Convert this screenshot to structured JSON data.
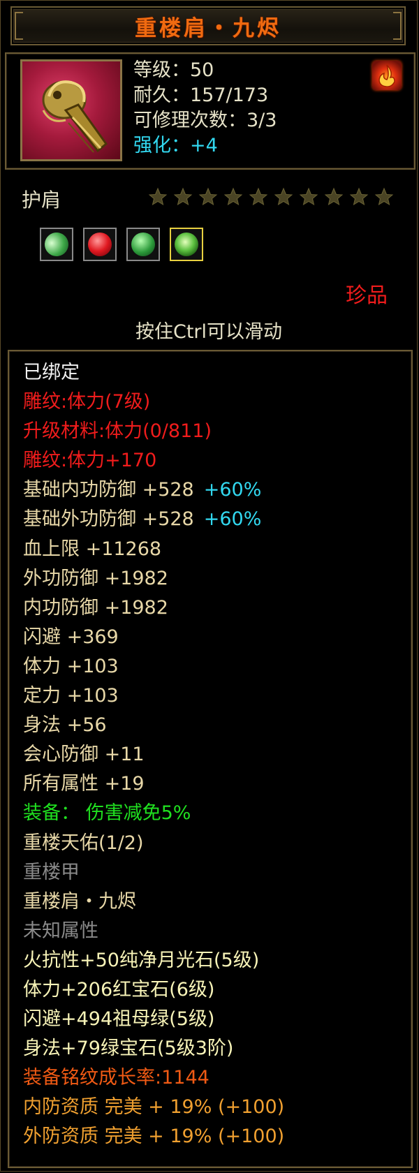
{
  "title": "重楼肩・九烬",
  "header": {
    "level": "等级：50",
    "durability": "耐久：157/173",
    "repairs": "可修理次数：3/3",
    "enhance": "强化：+4"
  },
  "slot_type": "护肩",
  "stars": {
    "total": 10,
    "filled": 0
  },
  "gems": [
    "moonstone-gem-icon",
    "ruby-gem-icon",
    "emerald-gem-icon",
    "green-gem-icon"
  ],
  "rarity": "珍品",
  "hint": "按住Ctrl可以滑动",
  "attributes": [
    {
      "text": "已绑定",
      "color": "white"
    },
    {
      "text": "雕纹:体力(7级)",
      "color": "red"
    },
    {
      "text": "升级材料:体力(0/811)",
      "color": "red"
    },
    {
      "text": "雕纹:体力+170",
      "color": "red"
    },
    {
      "text": "基础内功防御 +528",
      "extra": "+60%",
      "color": "gold"
    },
    {
      "text": "基础外功防御 +528",
      "extra": "+60%",
      "color": "gold"
    },
    {
      "text": "血上限 +11268",
      "color": "gold"
    },
    {
      "text": "外功防御 +1982",
      "color": "gold"
    },
    {
      "text": "内功防御 +1982",
      "color": "gold"
    },
    {
      "text": "闪避 +369",
      "color": "gold"
    },
    {
      "text": "体力 +103",
      "color": "gold"
    },
    {
      "text": "定力 +103",
      "color": "gold"
    },
    {
      "text": "身法 +56",
      "color": "gold"
    },
    {
      "text": "会心防御 +11",
      "color": "gold"
    },
    {
      "text": "所有属性 +19",
      "color": "gold"
    },
    {
      "text": "装备： 伤害减免5%",
      "color": "green"
    },
    {
      "text": "重楼天佑(1/2)",
      "color": "gold"
    },
    {
      "text": "重楼甲",
      "color": "gray"
    },
    {
      "text": "重楼肩・九烬",
      "color": "gold"
    },
    {
      "text": "未知属性",
      "color": "gray"
    },
    {
      "text": "火抗性+50纯净月光石(5级)",
      "color": "yellow"
    },
    {
      "text": "体力+206红宝石(6级)",
      "color": "yellow"
    },
    {
      "text": "闪避+494祖母绿(5级)",
      "color": "yellow"
    },
    {
      "text": "身法+79绿宝石(5级3阶)",
      "color": "yellow"
    },
    {
      "text": "装备铭纹成长率:1144",
      "color": "orange"
    },
    {
      "text": "内防资质 完美 + 19% (+100)",
      "color": "amber"
    },
    {
      "text": "外防资质 完美 + 19% (+100)",
      "color": "amber"
    }
  ],
  "colors": {
    "title": "#f06a10",
    "rarity": "#f01c1c",
    "frame": "#6a5a34"
  }
}
